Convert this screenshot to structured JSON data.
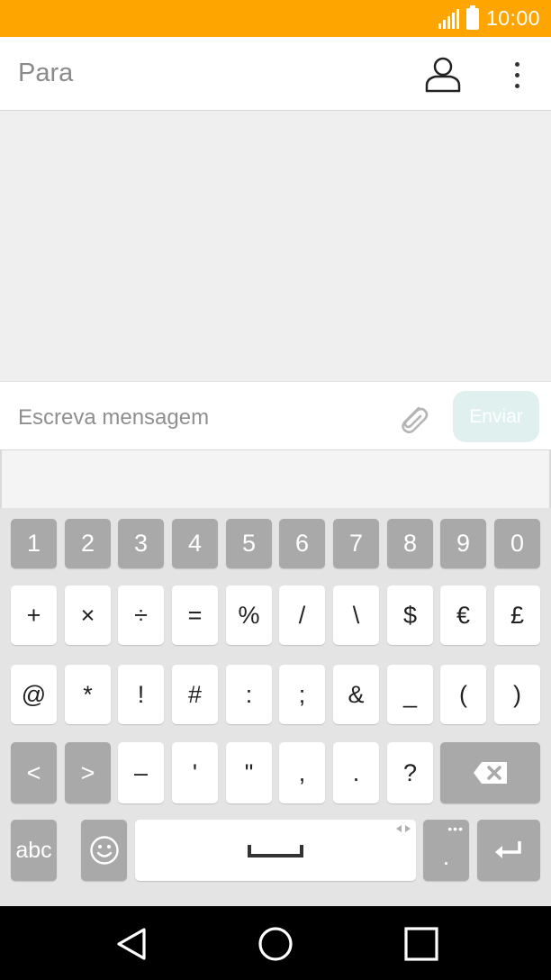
{
  "status_bar": {
    "time": "10:00"
  },
  "toolbar": {
    "to_placeholder": "Para"
  },
  "compose": {
    "placeholder": "Escreva mensagem",
    "send_label": "Enviar"
  },
  "keyboard": {
    "row1": [
      "1",
      "2",
      "3",
      "4",
      "5",
      "6",
      "7",
      "8",
      "9",
      "0"
    ],
    "row2": [
      "+",
      "×",
      "÷",
      "=",
      "%",
      "/",
      "\\",
      "$",
      "€",
      "£"
    ],
    "row3": [
      "@",
      "*",
      "!",
      "#",
      ":",
      ";",
      "&",
      "_",
      "(",
      ")"
    ],
    "row4": [
      "<",
      ">",
      "–",
      "'",
      "\"",
      ",",
      ".",
      "?"
    ],
    "abc_label": "abc",
    "dot_label": "."
  },
  "colors": {
    "status_bar": "#ffa500",
    "send_button": "#dff0ef",
    "dark_key": "#a9a9a9"
  }
}
